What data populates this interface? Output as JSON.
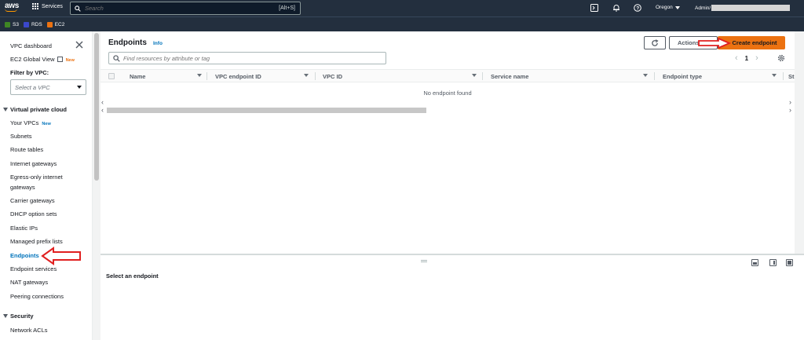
{
  "topnav": {
    "logo": "aws",
    "services_label": "Services",
    "search_placeholder": "Search",
    "search_shortcut": "[Alt+S]",
    "region": "Oregon",
    "account": "Admin/"
  },
  "favorites": [
    {
      "label": "S3",
      "color": "#3f8624"
    },
    {
      "label": "RDS",
      "color": "#3b48cc"
    },
    {
      "label": "EC2",
      "color": "#ec7211"
    }
  ],
  "sidebar": {
    "vpc_dashboard": "VPC dashboard",
    "ec2_global_view": "EC2 Global View",
    "ec2_badge": "New",
    "filter_label": "Filter by VPC:",
    "select_placeholder": "Select a VPC",
    "section_vpc": "Virtual private cloud",
    "items": [
      {
        "label": "Your VPCs",
        "badge": "New"
      },
      {
        "label": "Subnets"
      },
      {
        "label": "Route tables"
      },
      {
        "label": "Internet gateways"
      },
      {
        "label": "Egress-only internet"
      },
      {
        "label": "gateways"
      },
      {
        "label": "Carrier gateways"
      },
      {
        "label": "DHCP option sets"
      },
      {
        "label": "Elastic IPs"
      },
      {
        "label": "Managed prefix lists"
      },
      {
        "label": "Endpoints"
      },
      {
        "label": "Endpoint services"
      },
      {
        "label": "NAT gateways"
      },
      {
        "label": "Peering connections"
      }
    ],
    "section_security": "Security",
    "security_items": [
      {
        "label": "Network ACLs"
      }
    ]
  },
  "main": {
    "title": "Endpoints",
    "info": "Info",
    "actions_label": "Actions",
    "create_label": "Create endpoint",
    "filter_placeholder": "Find resources by attribute or tag",
    "page_number": "1",
    "columns": [
      "Name",
      "VPC endpoint ID",
      "VPC ID",
      "Service name",
      "Endpoint type",
      "St"
    ],
    "empty_message": "No endpoint found"
  },
  "bottom": {
    "title": "Select an endpoint"
  },
  "colors": {
    "nav_bg": "#232f3e",
    "primary_button": "#ec7211",
    "link": "#0073bb",
    "annotation_arrow": "#e02020"
  }
}
